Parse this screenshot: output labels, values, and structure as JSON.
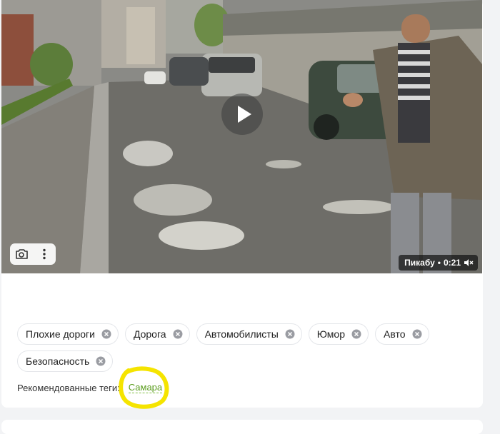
{
  "video": {
    "watermark_site": "Пикабу",
    "watermark_separator": "•",
    "duration": "0:21",
    "icons": {
      "play": "play-icon",
      "screenshot": "camera-icon",
      "more": "more-vertical-icon",
      "volume": "volume-muted-icon"
    }
  },
  "tags": [
    {
      "label": "Плохие дороги"
    },
    {
      "label": "Дорога"
    },
    {
      "label": "Автомобилисты"
    },
    {
      "label": "Юмор"
    },
    {
      "label": "Авто"
    },
    {
      "label": "Безопасность"
    }
  ],
  "recommended": {
    "label": "Рекомендованные теги:",
    "tag": "Самара"
  },
  "colors": {
    "recommended_tag": "#5a9c1d",
    "highlight_circle": "#f5e400"
  }
}
